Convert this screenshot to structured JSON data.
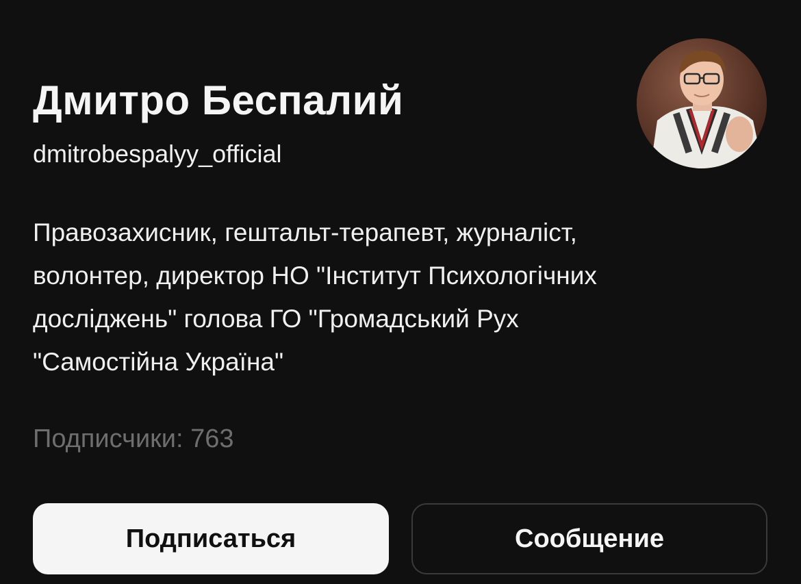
{
  "profile": {
    "display_name": "Дмитро Беспалий",
    "username": "dmitrobespalyy_official",
    "avatar_icon": "avatar-photo-icon",
    "bio_lines": [
      "Правозахисник, гештальт-терапевт, журналіст,",
      "волонтер, директор НО \"Інститут Психологічних",
      "досліджень\" голова ГО \"Громадський Рух",
      "\"Самостійна Україна\""
    ],
    "followers_text": "Подписчики: 763"
  },
  "actions": {
    "follow_label": "Подписаться",
    "message_label": "Сообщение"
  },
  "colors": {
    "background": "#101010",
    "primary_text": "#f5f5f5",
    "secondary_text": "#6e6e6e",
    "follow_button_bg": "#f5f5f5",
    "message_button_border": "#3a3a3a"
  }
}
